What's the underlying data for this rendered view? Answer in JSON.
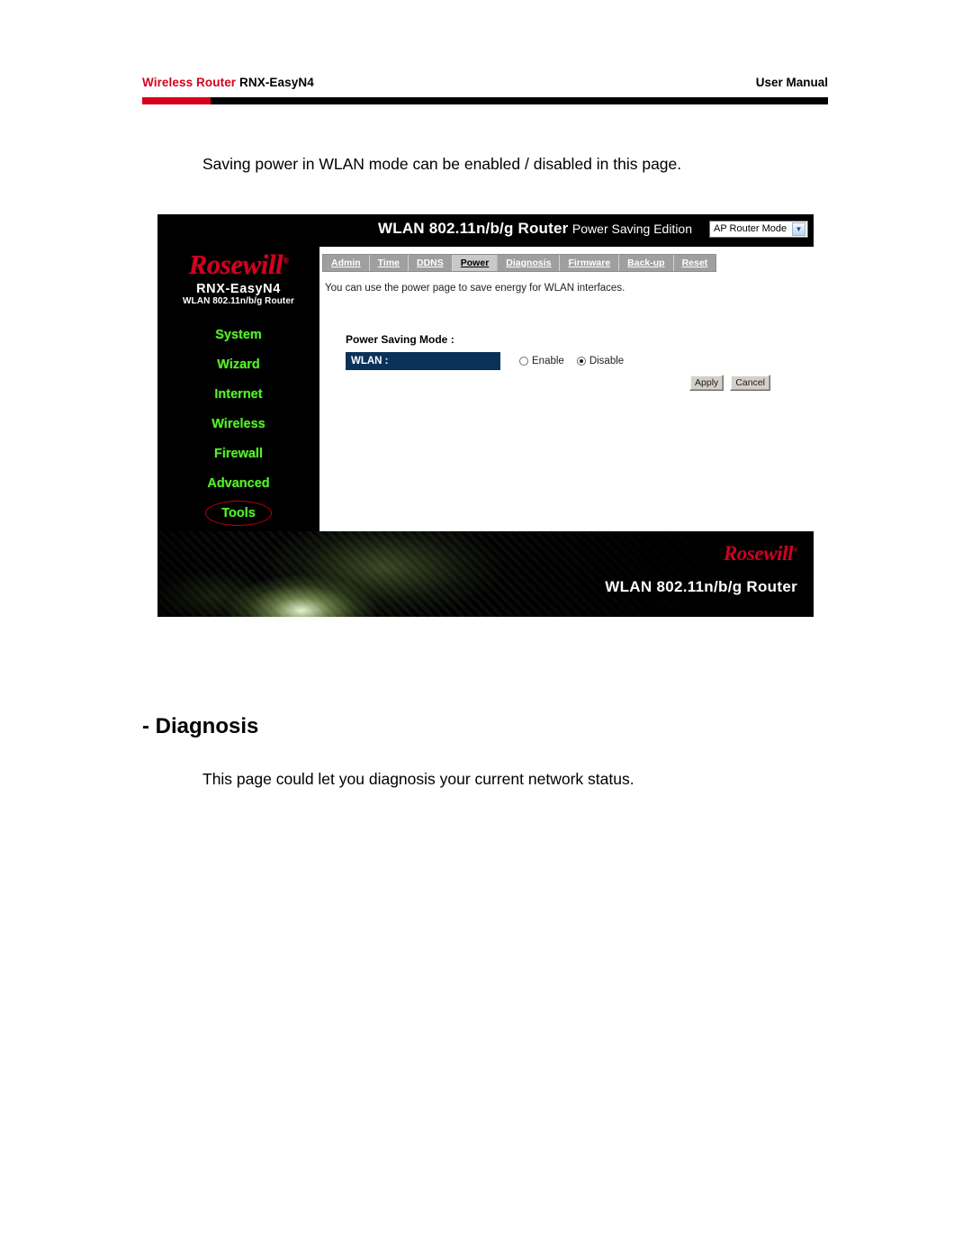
{
  "header": {
    "left_red": "Wireless Router",
    "left_black": "RNX-EasyN4",
    "right": "User Manual"
  },
  "intro": {
    "text": "Saving power in WLAN mode can be enabled / disabled in this page."
  },
  "router_ui": {
    "topbar": {
      "title_bold": "WLAN 802.11n/b/g Router",
      "title_light": "Power Saving Edition",
      "mode_select_value": "AP Router Mode",
      "mode_select_arrow": "chevron-down-icon"
    },
    "sidebar": {
      "brand": "Rosewill",
      "brand_mark": "®",
      "model": "RNX-EasyN4",
      "model_sub": "WLAN 802.11n/b/g Router",
      "items": [
        {
          "label": "System",
          "current": false
        },
        {
          "label": "Wizard",
          "current": false
        },
        {
          "label": "Internet",
          "current": false
        },
        {
          "label": "Wireless",
          "current": false
        },
        {
          "label": "Firewall",
          "current": false
        },
        {
          "label": "Advanced",
          "current": false
        },
        {
          "label": "Tools",
          "current": true
        }
      ],
      "highlight_color": "#c4000e",
      "menu_color": "#55ef2a"
    },
    "tabs": [
      {
        "label": "Admin",
        "active": false
      },
      {
        "label": "Time",
        "active": false
      },
      {
        "label": "DDNS",
        "active": false
      },
      {
        "label": "Power",
        "active": true
      },
      {
        "label": "Diagnosis",
        "active": false
      },
      {
        "label": "Firmware",
        "active": false
      },
      {
        "label": "Back-up",
        "active": false
      },
      {
        "label": "Reset",
        "active": false
      }
    ],
    "content": {
      "description": "You can use the power page to save energy for WLAN interfaces.",
      "section_label": "Power Saving Mode :",
      "field_key": "WLAN :",
      "field_key_bg": "#0a3259",
      "radios": [
        {
          "label": "Enable",
          "checked": false
        },
        {
          "label": "Disable",
          "checked": true
        }
      ],
      "buttons": [
        {
          "label": "Apply"
        },
        {
          "label": "Cancel"
        }
      ]
    },
    "banner": {
      "brand": "Rosewill",
      "brand_mark": "®",
      "model": "WLAN 802.11n/b/g Router"
    }
  },
  "diagnosis_section": {
    "heading": "- Diagnosis",
    "text": "This page could let you diagnosis your current network status."
  }
}
